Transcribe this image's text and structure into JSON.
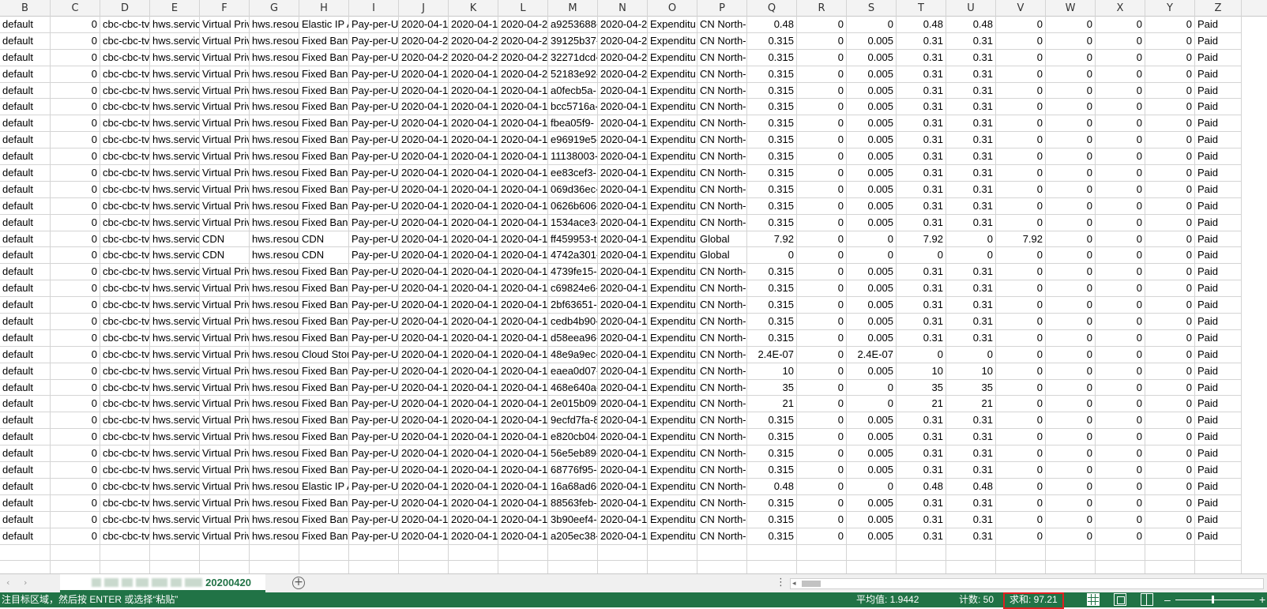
{
  "columns": [
    "B",
    "C",
    "D",
    "E",
    "F",
    "G",
    "H",
    "I",
    "J",
    "K",
    "L",
    "M",
    "N",
    "O",
    "P",
    "Q",
    "R",
    "S",
    "T",
    "U",
    "V",
    "W",
    "X",
    "Y",
    "Z"
  ],
  "rows": [
    [
      "default",
      "0",
      "cbc-cbc-tv",
      "hws.servic",
      "Virtual Priv",
      "hws.resou",
      "Elastic IP A",
      "Pay-per-U",
      "2020-04-1!",
      "2020-04-1!",
      "2020-04-2(",
      "a9253688-",
      "2020-04-2(",
      "Expenditu",
      "CN North-",
      "0.48",
      "0",
      "0",
      "0.48",
      "0.48",
      "0",
      "0",
      "0",
      "0",
      "Paid"
    ],
    [
      "default",
      "0",
      "cbc-cbc-tv",
      "hws.servic",
      "Virtual Priv",
      "hws.resou",
      "Fixed Ban",
      "Pay-per-U",
      "2020-04-2(",
      "2020-04-2(",
      "2020-04-2(",
      "39125b37-",
      "2020-04-2(",
      "Expenditu",
      "CN North-",
      "0.315",
      "0",
      "0.005",
      "0.31",
      "0.31",
      "0",
      "0",
      "0",
      "0",
      "Paid"
    ],
    [
      "default",
      "0",
      "cbc-cbc-tv",
      "hws.servic",
      "Virtual Priv",
      "hws.resou",
      "Fixed Ban",
      "Pay-per-U",
      "2020-04-2(",
      "2020-04-2(",
      "2020-04-2(",
      "32271dcd-",
      "2020-04-2(",
      "Expenditu",
      "CN North-",
      "0.315",
      "0",
      "0.005",
      "0.31",
      "0.31",
      "0",
      "0",
      "0",
      "0",
      "Paid"
    ],
    [
      "default",
      "0",
      "cbc-cbc-tv",
      "hws.servic",
      "Virtual Priv",
      "hws.resou",
      "Fixed Ban",
      "Pay-per-U",
      "2020-04-1!",
      "2020-04-1!",
      "2020-04-2(",
      "52183e92-",
      "2020-04-2(",
      "Expenditu",
      "CN North-",
      "0.315",
      "0",
      "0.005",
      "0.31",
      "0.31",
      "0",
      "0",
      "0",
      "0",
      "Paid"
    ],
    [
      "default",
      "0",
      "cbc-cbc-tv",
      "hws.servic",
      "Virtual Priv",
      "hws.resou",
      "Fixed Ban",
      "Pay-per-U",
      "2020-04-1!",
      "2020-04-1!",
      "2020-04-1!",
      "a0fecb5a-",
      "2020-04-1!",
      "Expenditu",
      "CN North-",
      "0.315",
      "0",
      "0.005",
      "0.31",
      "0.31",
      "0",
      "0",
      "0",
      "0",
      "Paid"
    ],
    [
      "default",
      "0",
      "cbc-cbc-tv",
      "hws.servic",
      "Virtual Priv",
      "hws.resou",
      "Fixed Ban",
      "Pay-per-U",
      "2020-04-1!",
      "2020-04-1!",
      "2020-04-1!",
      "bcc5716a-",
      "2020-04-1!",
      "Expenditu",
      "CN North-",
      "0.315",
      "0",
      "0.005",
      "0.31",
      "0.31",
      "0",
      "0",
      "0",
      "0",
      "Paid"
    ],
    [
      "default",
      "0",
      "cbc-cbc-tv",
      "hws.servic",
      "Virtual Priv",
      "hws.resou",
      "Fixed Ban",
      "Pay-per-U",
      "2020-04-1!",
      "2020-04-1!",
      "2020-04-1!",
      "fbea05f9-",
      "2020-04-1!",
      "Expenditu",
      "CN North-",
      "0.315",
      "0",
      "0.005",
      "0.31",
      "0.31",
      "0",
      "0",
      "0",
      "0",
      "Paid"
    ],
    [
      "default",
      "0",
      "cbc-cbc-tv",
      "hws.servic",
      "Virtual Priv",
      "hws.resou",
      "Fixed Ban",
      "Pay-per-U",
      "2020-04-1!",
      "2020-04-1!",
      "2020-04-1!",
      "e96919e5-",
      "2020-04-1!",
      "Expenditu",
      "CN North-",
      "0.315",
      "0",
      "0.005",
      "0.31",
      "0.31",
      "0",
      "0",
      "0",
      "0",
      "Paid"
    ],
    [
      "default",
      "0",
      "cbc-cbc-tv",
      "hws.servic",
      "Virtual Priv",
      "hws.resou",
      "Fixed Ban",
      "Pay-per-U",
      "2020-04-1!",
      "2020-04-1!",
      "2020-04-1!",
      "11138003-",
      "2020-04-1!",
      "Expenditu",
      "CN North-",
      "0.315",
      "0",
      "0.005",
      "0.31",
      "0.31",
      "0",
      "0",
      "0",
      "0",
      "Paid"
    ],
    [
      "default",
      "0",
      "cbc-cbc-tv",
      "hws.servic",
      "Virtual Priv",
      "hws.resou",
      "Fixed Ban",
      "Pay-per-U",
      "2020-04-1!",
      "2020-04-1!",
      "2020-04-1!",
      "ee83cef3-",
      "2020-04-1!",
      "Expenditu",
      "CN North-",
      "0.315",
      "0",
      "0.005",
      "0.31",
      "0.31",
      "0",
      "0",
      "0",
      "0",
      "Paid"
    ],
    [
      "default",
      "0",
      "cbc-cbc-tv",
      "hws.servic",
      "Virtual Priv",
      "hws.resou",
      "Fixed Ban",
      "Pay-per-U",
      "2020-04-1!",
      "2020-04-1!",
      "2020-04-1!",
      "069d36ec-",
      "2020-04-1!",
      "Expenditu",
      "CN North-",
      "0.315",
      "0",
      "0.005",
      "0.31",
      "0.31",
      "0",
      "0",
      "0",
      "0",
      "Paid"
    ],
    [
      "default",
      "0",
      "cbc-cbc-tv",
      "hws.servic",
      "Virtual Priv",
      "hws.resou",
      "Fixed Ban",
      "Pay-per-U",
      "2020-04-1!",
      "2020-04-1!",
      "2020-04-1!",
      "0626b606-",
      "2020-04-1!",
      "Expenditu",
      "CN North-",
      "0.315",
      "0",
      "0.005",
      "0.31",
      "0.31",
      "0",
      "0",
      "0",
      "0",
      "Paid"
    ],
    [
      "default",
      "0",
      "cbc-cbc-tv",
      "hws.servic",
      "Virtual Priv",
      "hws.resou",
      "Fixed Ban",
      "Pay-per-U",
      "2020-04-1!",
      "2020-04-1!",
      "2020-04-1!",
      "1534ace3-",
      "2020-04-1!",
      "Expenditu",
      "CN North-",
      "0.315",
      "0",
      "0.005",
      "0.31",
      "0.31",
      "0",
      "0",
      "0",
      "0",
      "Paid"
    ],
    [
      "default",
      "0",
      "cbc-cbc-tv",
      "hws.servic",
      "CDN",
      "hws.resou",
      "CDN",
      "Pay-per-U",
      "2020-04-1!",
      "2020-04-1!",
      "2020-04-1!",
      "ff459953-t",
      "2020-04-1!",
      "Expenditu",
      "Global",
      "7.92",
      "0",
      "0",
      "7.92",
      "0",
      "7.92",
      "0",
      "0",
      "0",
      "Paid"
    ],
    [
      "default",
      "0",
      "cbc-cbc-tv",
      "hws.servic",
      "CDN",
      "hws.resou",
      "CDN",
      "Pay-per-U",
      "2020-04-1!",
      "2020-04-1!",
      "2020-04-1!",
      "4742a301-",
      "2020-04-1!",
      "Expenditu",
      "Global",
      "0",
      "0",
      "0",
      "0",
      "0",
      "0",
      "0",
      "0",
      "0",
      "Paid"
    ],
    [
      "default",
      "0",
      "cbc-cbc-tv",
      "hws.servic",
      "Virtual Priv",
      "hws.resou",
      "Fixed Ban",
      "Pay-per-U",
      "2020-04-1!",
      "2020-04-1!",
      "2020-04-1!",
      "4739fe15-",
      "2020-04-1!",
      "Expenditu",
      "CN North-",
      "0.315",
      "0",
      "0.005",
      "0.31",
      "0.31",
      "0",
      "0",
      "0",
      "0",
      "Paid"
    ],
    [
      "default",
      "0",
      "cbc-cbc-tv",
      "hws.servic",
      "Virtual Priv",
      "hws.resou",
      "Fixed Ban",
      "Pay-per-U",
      "2020-04-1!",
      "2020-04-1!",
      "2020-04-1!",
      "c69824e6-",
      "2020-04-1!",
      "Expenditu",
      "CN North-",
      "0.315",
      "0",
      "0.005",
      "0.31",
      "0.31",
      "0",
      "0",
      "0",
      "0",
      "Paid"
    ],
    [
      "default",
      "0",
      "cbc-cbc-tv",
      "hws.servic",
      "Virtual Priv",
      "hws.resou",
      "Fixed Ban",
      "Pay-per-U",
      "2020-04-1!",
      "2020-04-1!",
      "2020-04-1!",
      "2bf63651-",
      "2020-04-1!",
      "Expenditu",
      "CN North-",
      "0.315",
      "0",
      "0.005",
      "0.31",
      "0.31",
      "0",
      "0",
      "0",
      "0",
      "Paid"
    ],
    [
      "default",
      "0",
      "cbc-cbc-tv",
      "hws.servic",
      "Virtual Priv",
      "hws.resou",
      "Fixed Ban",
      "Pay-per-U",
      "2020-04-1!",
      "2020-04-1!",
      "2020-04-1!",
      "cedb4b90-",
      "2020-04-1!",
      "Expenditu",
      "CN North-",
      "0.315",
      "0",
      "0.005",
      "0.31",
      "0.31",
      "0",
      "0",
      "0",
      "0",
      "Paid"
    ],
    [
      "default",
      "0",
      "cbc-cbc-tv",
      "hws.servic",
      "Virtual Priv",
      "hws.resou",
      "Fixed Ban",
      "Pay-per-U",
      "2020-04-1!",
      "2020-04-1!",
      "2020-04-1!",
      "d58eea96-",
      "2020-04-1!",
      "Expenditu",
      "CN North-",
      "0.315",
      "0",
      "0.005",
      "0.31",
      "0.31",
      "0",
      "0",
      "0",
      "0",
      "Paid"
    ],
    [
      "default",
      "0",
      "cbc-cbc-tv",
      "hws.servic",
      "Virtual Priv",
      "hws.resou",
      "Cloud Stor",
      "Pay-per-U",
      "2020-04-1!",
      "2020-04-1!",
      "2020-04-1!",
      "48e9a9ec-",
      "2020-04-1!",
      "Expenditu",
      "CN North-",
      "2.4E-07",
      "0",
      "2.4E-07",
      "0",
      "0",
      "0",
      "0",
      "0",
      "0",
      "Paid"
    ],
    [
      "default",
      "0",
      "cbc-cbc-tv",
      "hws.servic",
      "Virtual Priv",
      "hws.resou",
      "Fixed Ban",
      "Pay-per-U",
      "2020-04-1!",
      "2020-04-1!",
      "2020-04-1!",
      "eaea0d07-",
      "2020-04-1!",
      "Expenditu",
      "CN North-",
      "10",
      "0",
      "0.005",
      "10",
      "10",
      "0",
      "0",
      "0",
      "0",
      "Paid"
    ],
    [
      "default",
      "0",
      "cbc-cbc-tv",
      "hws.servic",
      "Virtual Priv",
      "hws.resou",
      "Fixed Ban",
      "Pay-per-U",
      "2020-04-1!",
      "2020-04-1!",
      "2020-04-1!",
      "468e640a-",
      "2020-04-1!",
      "Expenditu",
      "CN North-",
      "35",
      "0",
      "0",
      "35",
      "35",
      "0",
      "0",
      "0",
      "0",
      "Paid"
    ],
    [
      "default",
      "0",
      "cbc-cbc-tv",
      "hws.servic",
      "Virtual Priv",
      "hws.resou",
      "Fixed Ban",
      "Pay-per-U",
      "2020-04-1!",
      "2020-04-1!",
      "2020-04-1!",
      "2e015b09-",
      "2020-04-1!",
      "Expenditu",
      "CN North-",
      "21",
      "0",
      "0",
      "21",
      "21",
      "0",
      "0",
      "0",
      "0",
      "Paid"
    ],
    [
      "default",
      "0",
      "cbc-cbc-tv",
      "hws.servic",
      "Virtual Priv",
      "hws.resou",
      "Fixed Ban",
      "Pay-per-U",
      "2020-04-1!",
      "2020-04-1!",
      "2020-04-1!",
      "9ecfd7fa-8",
      "2020-04-1!",
      "Expenditu",
      "CN North-",
      "0.315",
      "0",
      "0.005",
      "0.31",
      "0.31",
      "0",
      "0",
      "0",
      "0",
      "Paid"
    ],
    [
      "default",
      "0",
      "cbc-cbc-tv",
      "hws.servic",
      "Virtual Priv",
      "hws.resou",
      "Fixed Ban",
      "Pay-per-U",
      "2020-04-1!",
      "2020-04-1!",
      "2020-04-1!",
      "e820cb04-",
      "2020-04-1!",
      "Expenditu",
      "CN North-",
      "0.315",
      "0",
      "0.005",
      "0.31",
      "0.31",
      "0",
      "0",
      "0",
      "0",
      "Paid"
    ],
    [
      "default",
      "0",
      "cbc-cbc-tv",
      "hws.servic",
      "Virtual Priv",
      "hws.resou",
      "Fixed Ban",
      "Pay-per-U",
      "2020-04-1!",
      "2020-04-1!",
      "2020-04-1!",
      "56e5eb89-",
      "2020-04-1!",
      "Expenditu",
      "CN North-",
      "0.315",
      "0",
      "0.005",
      "0.31",
      "0.31",
      "0",
      "0",
      "0",
      "0",
      "Paid"
    ],
    [
      "default",
      "0",
      "cbc-cbc-tv",
      "hws.servic",
      "Virtual Priv",
      "hws.resou",
      "Fixed Ban",
      "Pay-per-U",
      "2020-04-1!",
      "2020-04-1!",
      "2020-04-1!",
      "68776f95-",
      "2020-04-1!",
      "Expenditu",
      "CN North-",
      "0.315",
      "0",
      "0.005",
      "0.31",
      "0.31",
      "0",
      "0",
      "0",
      "0",
      "Paid"
    ],
    [
      "default",
      "0",
      "cbc-cbc-tv",
      "hws.servic",
      "Virtual Priv",
      "hws.resou",
      "Elastic IP A",
      "Pay-per-U",
      "2020-04-1!",
      "2020-04-1!",
      "2020-04-1!",
      "16a68ad6-",
      "2020-04-1!",
      "Expenditu",
      "CN North-",
      "0.48",
      "0",
      "0",
      "0.48",
      "0.48",
      "0",
      "0",
      "0",
      "0",
      "Paid"
    ],
    [
      "default",
      "0",
      "cbc-cbc-tv",
      "hws.servic",
      "Virtual Priv",
      "hws.resou",
      "Fixed Ban",
      "Pay-per-U",
      "2020-04-1!",
      "2020-04-1!",
      "2020-04-1!",
      "88563feb-",
      "2020-04-1!",
      "Expenditu",
      "CN North-",
      "0.315",
      "0",
      "0.005",
      "0.31",
      "0.31",
      "0",
      "0",
      "0",
      "0",
      "Paid"
    ],
    [
      "default",
      "0",
      "cbc-cbc-tv",
      "hws.servic",
      "Virtual Priv",
      "hws.resou",
      "Fixed Ban",
      "Pay-per-U",
      "2020-04-1!",
      "2020-04-1!",
      "2020-04-1!",
      "3b90eef4-",
      "2020-04-1!",
      "Expenditu",
      "CN North-",
      "0.315",
      "0",
      "0.005",
      "0.31",
      "0.31",
      "0",
      "0",
      "0",
      "0",
      "Paid"
    ],
    [
      "default",
      "0",
      "cbc-cbc-tv",
      "hws.servic",
      "Virtual Priv",
      "hws.resou",
      "Fixed Ban",
      "Pay-per-U",
      "2020-04-1!",
      "2020-04-1!",
      "2020-04-1!",
      "a205ec38-",
      "2020-04-1!",
      "Expenditu",
      "CN North-",
      "0.315",
      "0",
      "0.005",
      "0.31",
      "0.31",
      "0",
      "0",
      "0",
      "0",
      "Paid"
    ]
  ],
  "numeric_columns": [
    1,
    15,
    16,
    17,
    18,
    19,
    20,
    21,
    22,
    23
  ],
  "sheet_tab": {
    "label": "20200420"
  },
  "status": {
    "message": "注目标区域，然后按 ENTER 或选择“粘贴”",
    "average": "平均值: 1.9442",
    "count": "计数: 50",
    "sum": "求和: 97.21"
  },
  "colors": {
    "accent": "#217346",
    "highlight_box": "#e02020"
  },
  "icons": [
    "scroll-left-icon",
    "scroll-right-icon",
    "add-sheet-icon",
    "more-options-icon",
    "normal-view-icon",
    "page-layout-icon",
    "page-break-icon",
    "zoom-out-icon",
    "zoom-in-icon"
  ]
}
